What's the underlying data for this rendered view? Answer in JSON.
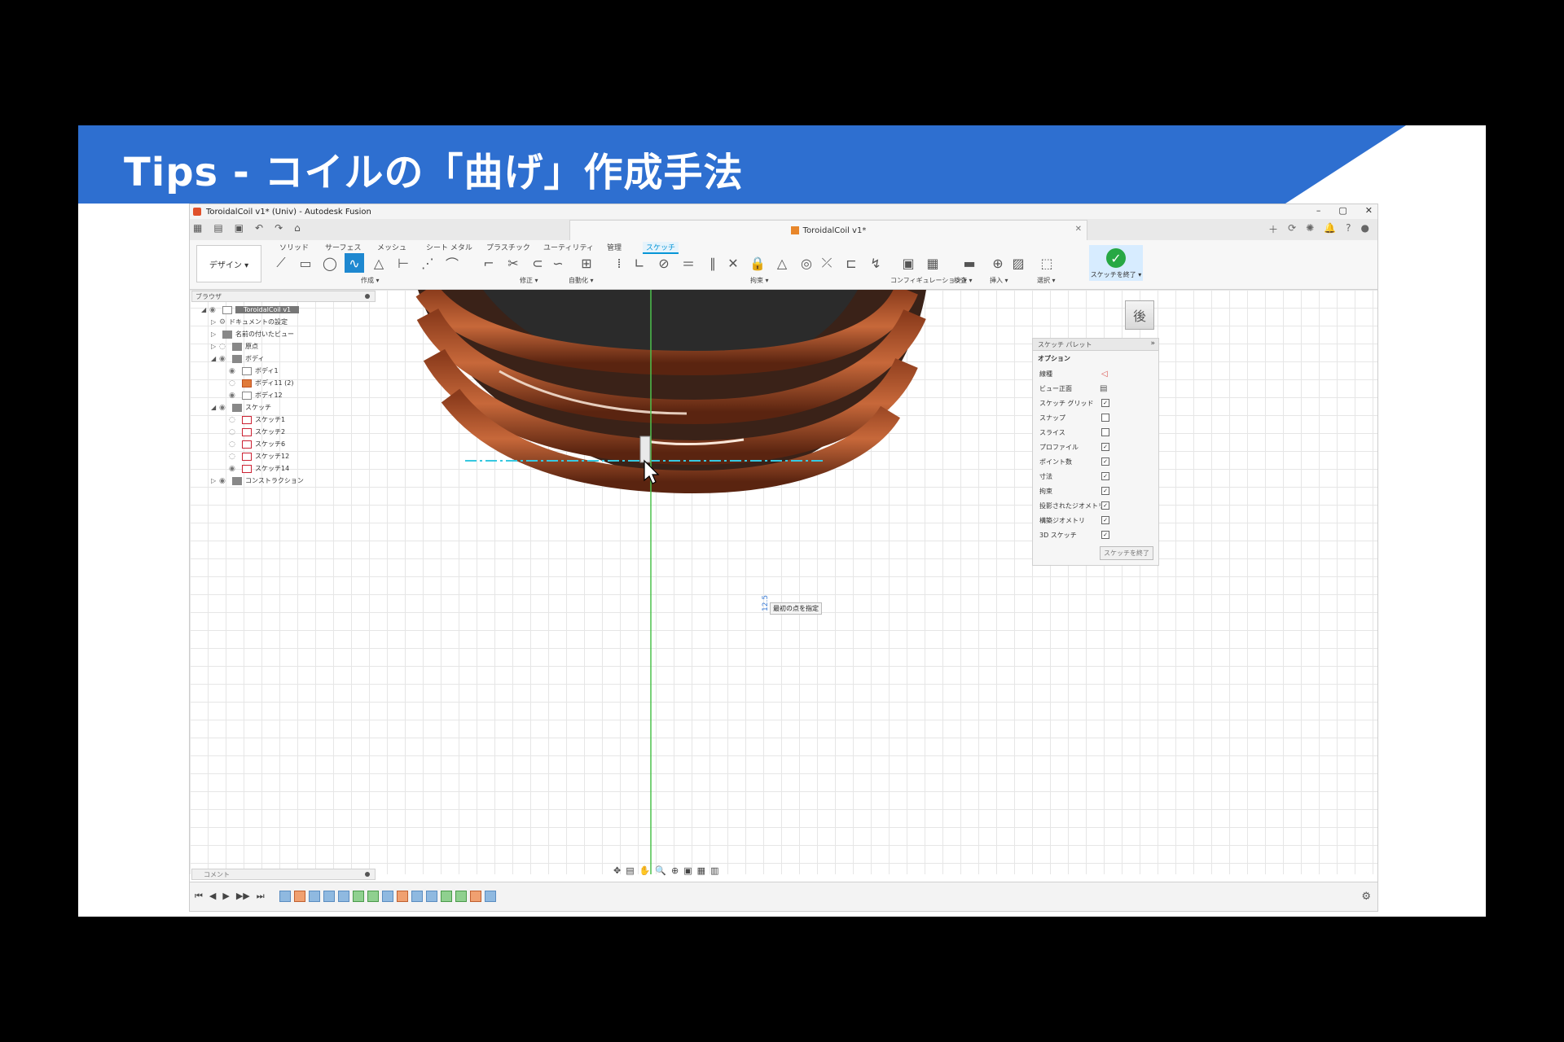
{
  "slide": {
    "title": "Tips - コイルの「曲げ」作成手法",
    "colors": {
      "banner": "#2e6fd0",
      "background": "#000000"
    }
  },
  "app": {
    "window_title": "ToroidalCoil v1* (Univ) - Autodesk Fusion",
    "doc_tab": "ToroidalCoil v1*",
    "window_controls": [
      "–",
      "▢",
      "✕"
    ]
  },
  "ribbon": {
    "workspace_button": "デザイン ▾",
    "tabs": [
      "ソリッド",
      "サーフェス",
      "メッシュ",
      "シート メタル",
      "プラスチック",
      "ユーティリティ",
      "管理",
      "スケッチ"
    ],
    "active_tab": "スケッチ",
    "groups": [
      "作成 ▾",
      "修正 ▾",
      "自動化 ▾",
      "拘束 ▾",
      "コンフィギュレーション ▾",
      "検査 ▾",
      "挿入 ▾",
      "選択 ▾"
    ],
    "finish_sketch": "スケッチを終了 ▾"
  },
  "browser": {
    "header": "ブラウザ",
    "root": "ToroidalCoil v1",
    "items": [
      {
        "label": "ドキュメントの設定",
        "level": 1
      },
      {
        "label": "名前の付いたビュー",
        "level": 1
      },
      {
        "label": "原点",
        "level": 1
      },
      {
        "label": "ボディ",
        "level": 1
      },
      {
        "label": "ボディ1",
        "level": 2
      },
      {
        "label": "ボディ11 (2)",
        "level": 2
      },
      {
        "label": "ボディ12",
        "level": 2
      },
      {
        "label": "スケッチ",
        "level": 1
      },
      {
        "label": "スケッチ1",
        "level": 2
      },
      {
        "label": "スケッチ2",
        "level": 2
      },
      {
        "label": "スケッチ6",
        "level": 2
      },
      {
        "label": "スケッチ12",
        "level": 2
      },
      {
        "label": "スケッチ14",
        "level": 2
      },
      {
        "label": "コンストラクション",
        "level": 1
      }
    ]
  },
  "viewcube": {
    "face": "後"
  },
  "palette": {
    "header": "スケッチ パレット",
    "section": "オプション",
    "rows": [
      {
        "label": "線種",
        "value": ""
      },
      {
        "label": "ビュー正面",
        "value": ""
      },
      {
        "label": "スケッチ グリッド",
        "value": "✓"
      },
      {
        "label": "スナップ",
        "value": ""
      },
      {
        "label": "スライス",
        "value": ""
      },
      {
        "label": "プロファイル",
        "value": "✓"
      },
      {
        "label": "ポイント数",
        "value": "✓"
      },
      {
        "label": "寸法",
        "value": "✓"
      },
      {
        "label": "拘束",
        "value": "✓"
      },
      {
        "label": "投影されたジオメトリ",
        "value": "✓"
      },
      {
        "label": "構築ジオメトリ",
        "value": "✓"
      },
      {
        "label": "3D スケッチ",
        "value": "✓"
      }
    ],
    "finish_button": "スケッチを終了"
  },
  "canvas": {
    "tooltip": "最初の点を指定",
    "dimension": "12.5"
  },
  "comment": {
    "label": "コメント"
  },
  "timeline": {
    "play_controls": [
      "⏮",
      "◀",
      "▶",
      "▶▶",
      "⏭"
    ]
  }
}
